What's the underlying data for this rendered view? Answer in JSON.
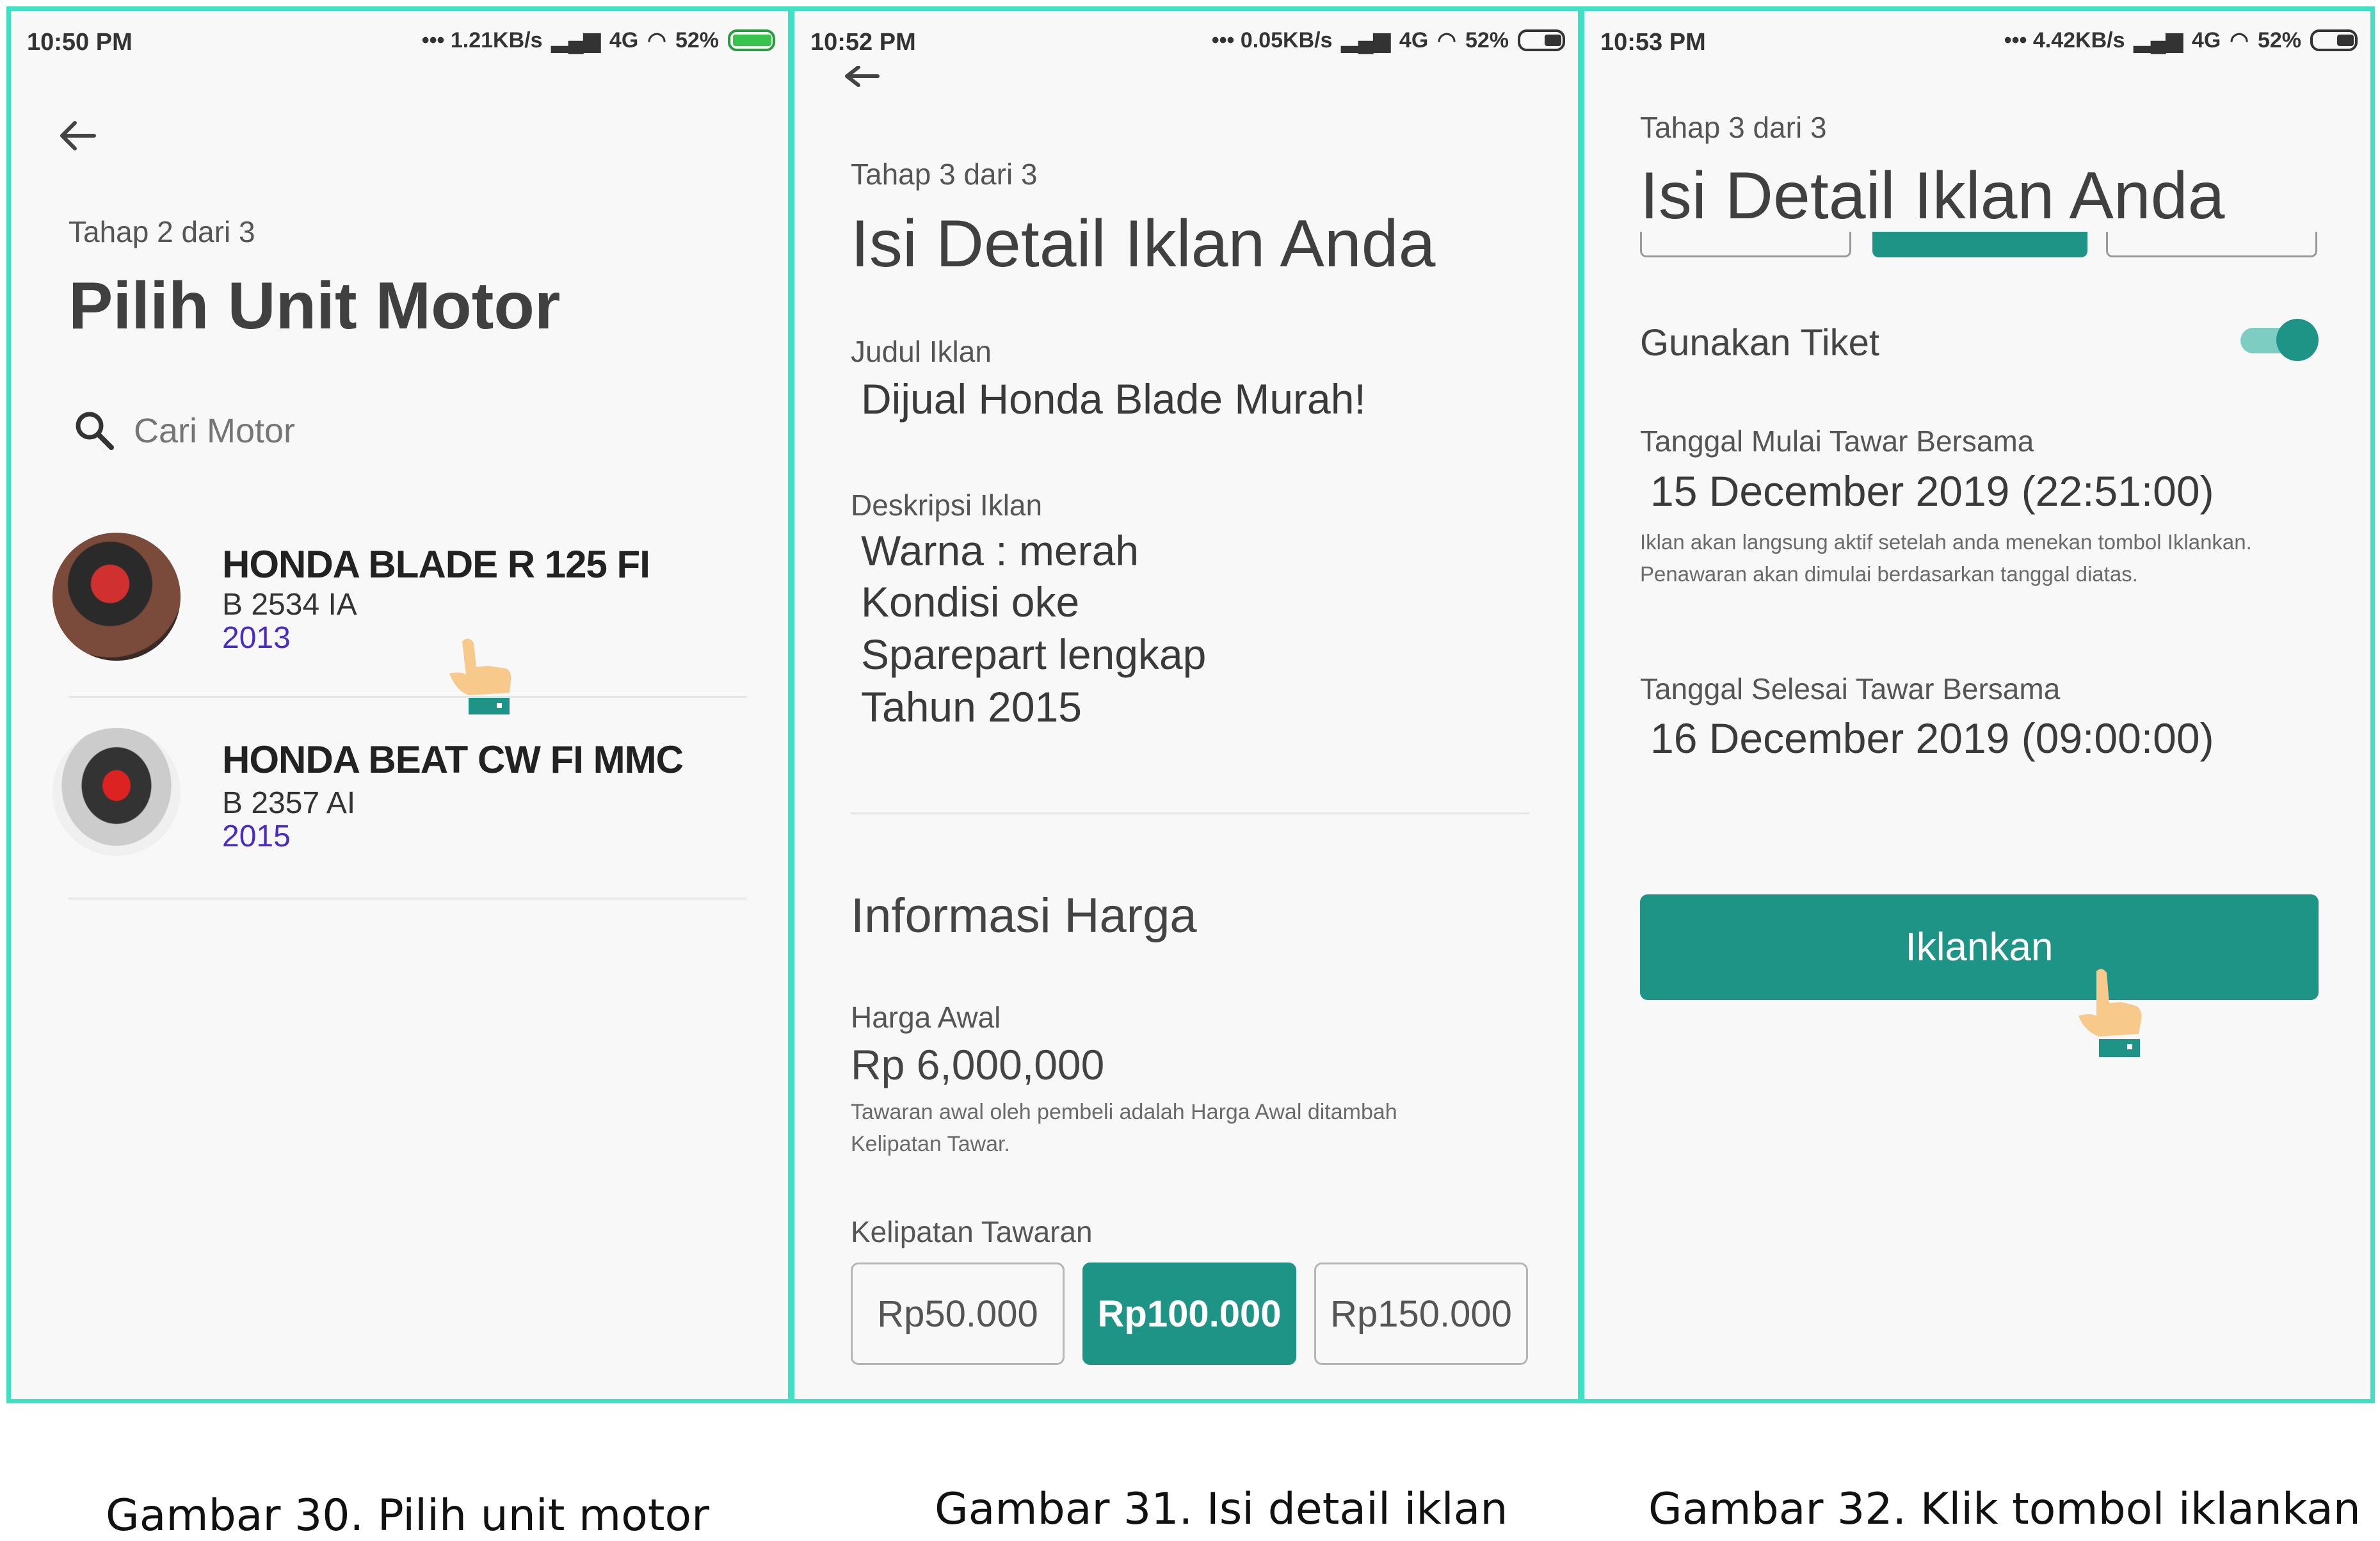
{
  "colors": {
    "frame": "#3fe0c3",
    "accent": "#1e9486",
    "year": "#4b2bc8"
  },
  "panel1": {
    "status": {
      "time": "10:50 PM",
      "speed": "••• 1.21KB/s",
      "network": "4G",
      "battery": "52%"
    },
    "back_icon": "arrow-left-icon",
    "step": "Tahap 2 dari 3",
    "title": "Pilih Unit Motor",
    "search": {
      "placeholder": "Cari Motor",
      "icon": "search-icon"
    },
    "motors": [
      {
        "name": "HONDA BLADE R 125 FI",
        "plate": "B 2534 IA",
        "year": "2013"
      },
      {
        "name": "HONDA BEAT CW FI MMC",
        "plate": "B 2357 AI",
        "year": "2015"
      }
    ]
  },
  "panel2": {
    "status": {
      "time": "10:52 PM",
      "speed": "••• 0.05KB/s",
      "network": "4G",
      "battery": "52%"
    },
    "step": "Tahap 3 dari 3",
    "title": "Isi Detail Iklan Anda",
    "judul_label": "Judul Iklan",
    "judul_value": "Dijual Honda Blade Murah!",
    "desc_label": "Deskripsi Iklan",
    "desc_lines": [
      "Warna : merah",
      "Kondisi oke",
      "Sparepart lengkap",
      "Tahun 2015"
    ],
    "section_title": "Informasi Harga",
    "harga_label": "Harga Awal",
    "harga_value": "Rp 6,000,000",
    "harga_note": "Tawaran awal oleh pembeli adalah Harga Awal ditambah Kelipatan Tawar.",
    "kelipatan_label": "Kelipatan Tawaran",
    "kelipatan_options": [
      "Rp50.000",
      "Rp100.000",
      "Rp150.000"
    ],
    "kelipatan_selected": "Rp100.000"
  },
  "panel3": {
    "status": {
      "time": "10:53 PM",
      "speed": "••• 4.42KB/s",
      "network": "4G",
      "battery": "52%"
    },
    "step": "Tahap 3 dari 3",
    "title": "Isi Detail Iklan Anda",
    "ticket_label": "Gunakan Tiket",
    "ticket_on": true,
    "start_label": "Tanggal Mulai Tawar Bersama",
    "start_value": "15 December 2019 (22:51:00)",
    "start_note": "Iklan akan langsung aktif setelah anda menekan tombol Iklankan. Penawaran akan dimulai berdasarkan tanggal diatas.",
    "end_label": "Tanggal Selesai Tawar Bersama",
    "end_value": "16 December 2019 (09:00:00)",
    "button_label": "Iklankan"
  },
  "captions": [
    "Gambar 30. Pilih unit motor",
    "Gambar 31. Isi detail iklan",
    "Gambar 32. Klik tombol iklankan"
  ]
}
